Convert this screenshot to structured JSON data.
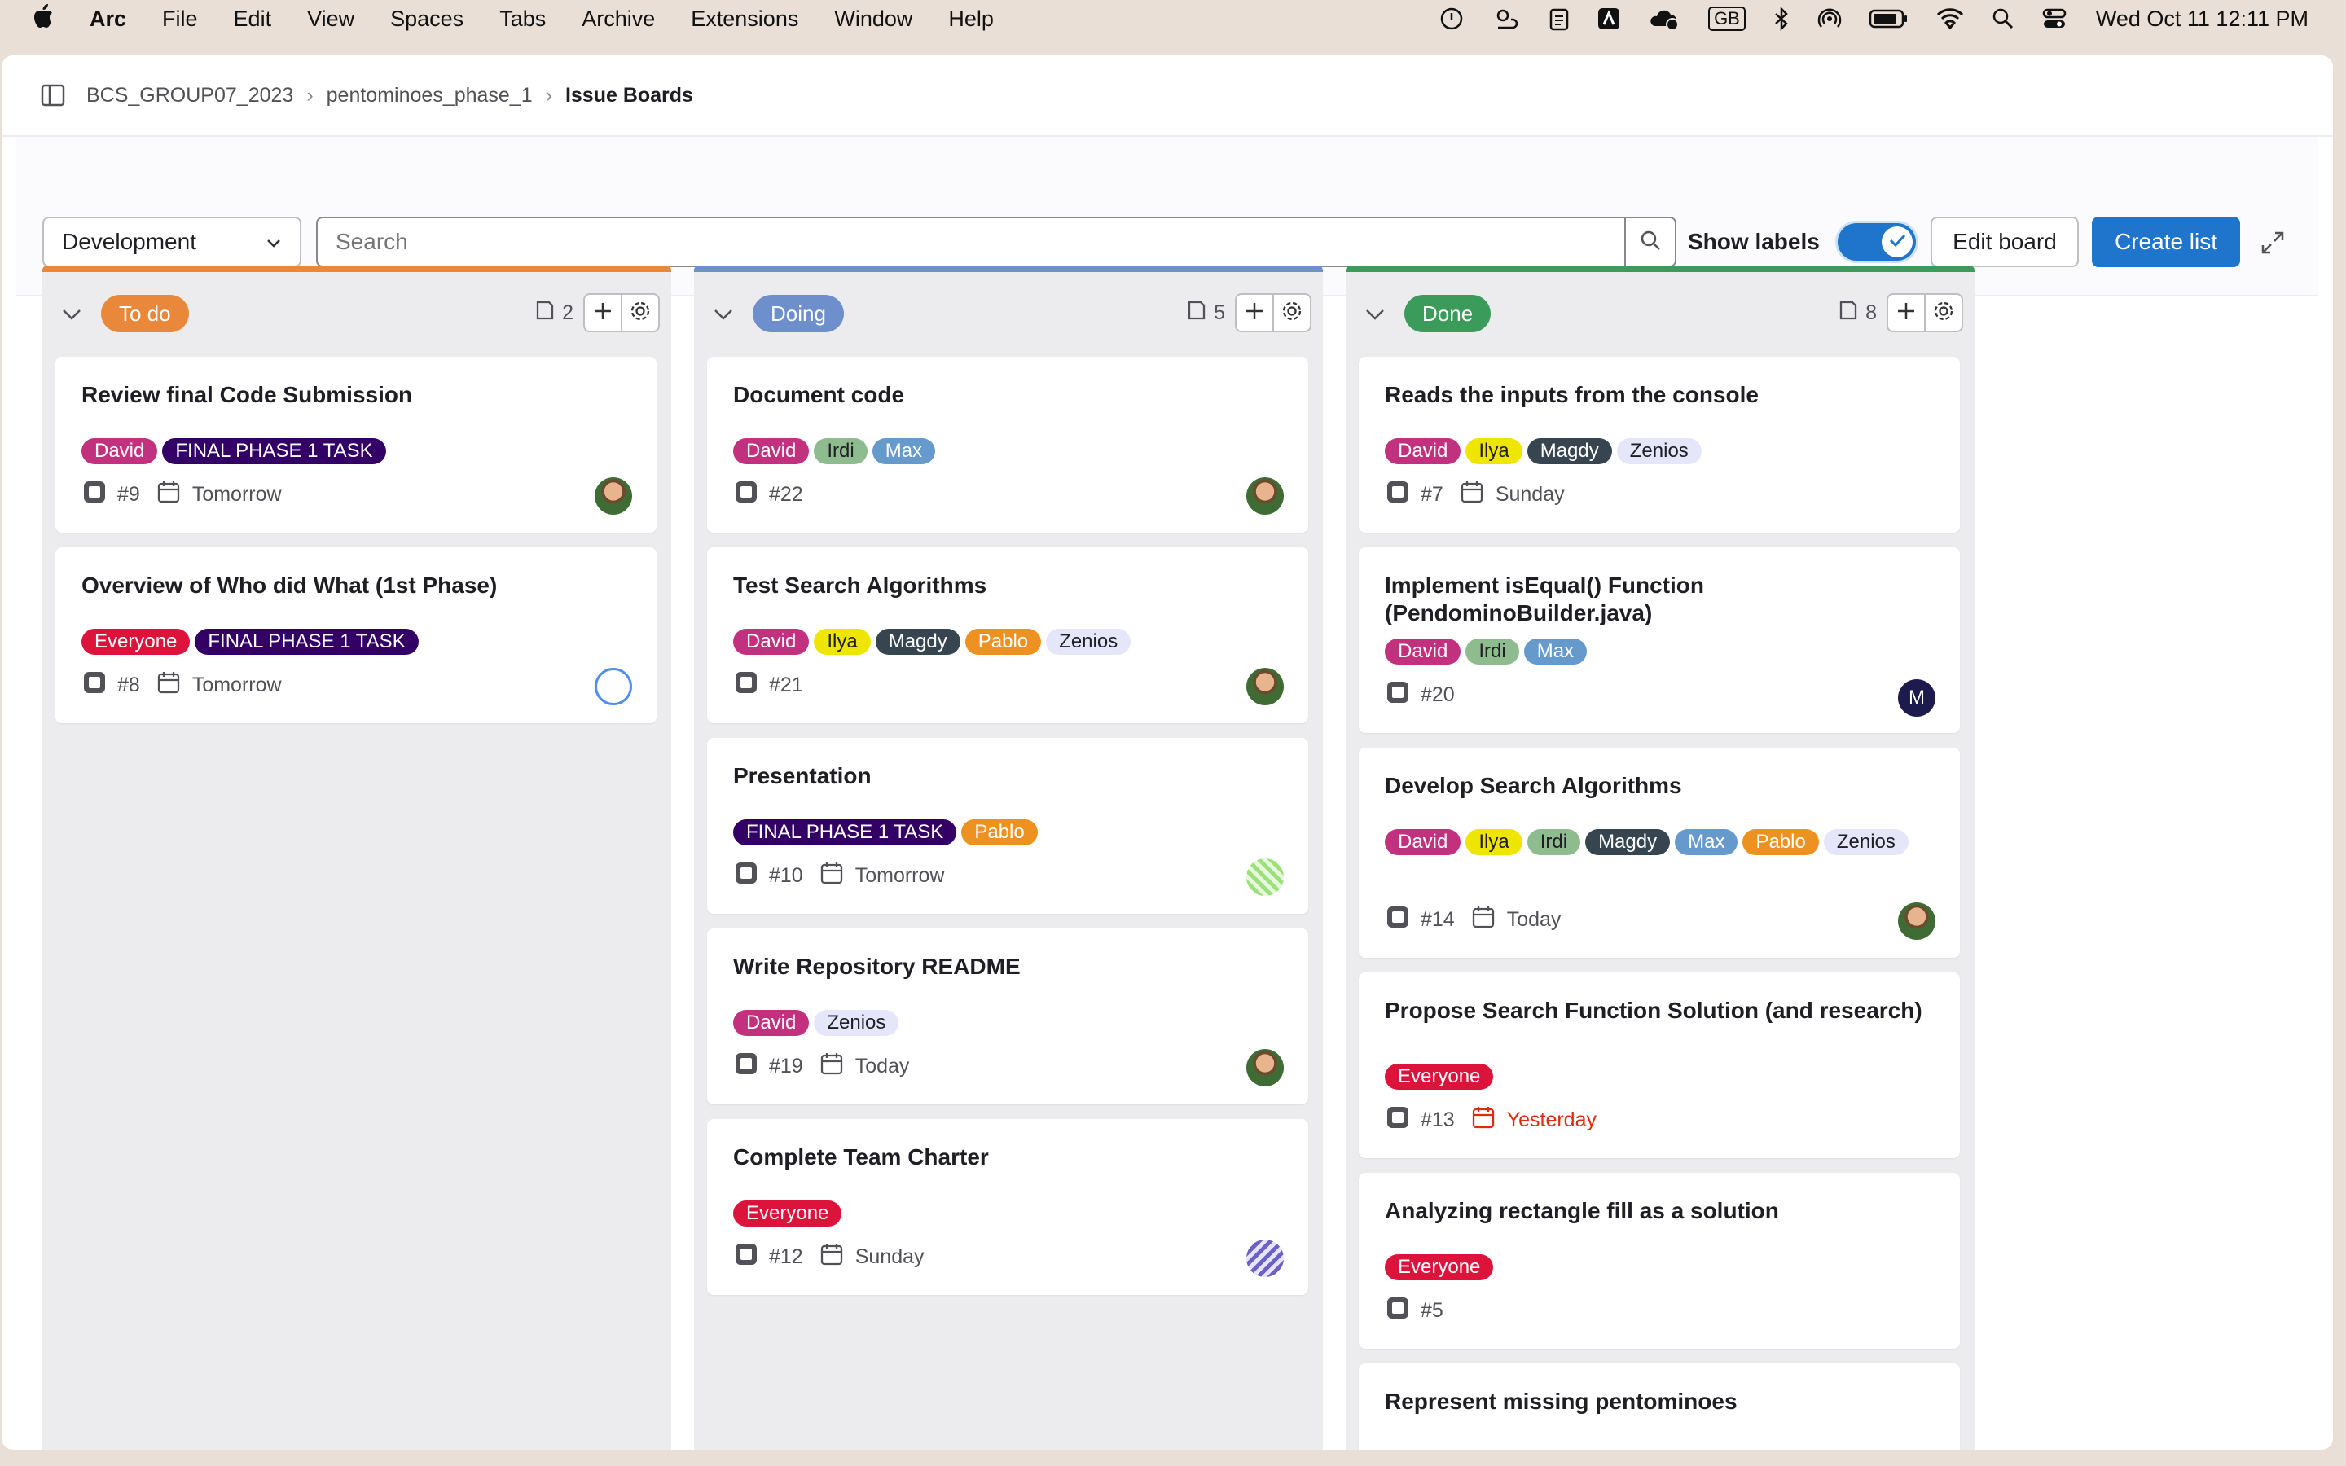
{
  "menubar": {
    "browser": "Arc",
    "items": [
      "File",
      "Edit",
      "View",
      "Spaces",
      "Tabs",
      "Archive",
      "Extensions",
      "Window",
      "Help"
    ],
    "input_source": "GB",
    "clock": "Wed Oct 11  12:11 PM"
  },
  "breadcrumb": {
    "group": "BCS_GROUP07_2023",
    "project": "pentominoes_phase_1",
    "page": "Issue Boards"
  },
  "toolbar": {
    "board_select": "Development",
    "search_placeholder": "Search",
    "show_labels": "Show labels",
    "show_labels_on": true,
    "edit_board": "Edit board",
    "create_list": "Create list"
  },
  "colors": {
    "accent": "#1f75cb",
    "todo": "#e9873a",
    "doing": "#6d8fcb",
    "done": "#3b9b5b"
  },
  "lists": [
    {
      "name": "To do",
      "count": "2",
      "cards": [
        {
          "title": "Review final Code Submission",
          "labels": [
            "David",
            "FINAL PHASE 1 TASK"
          ],
          "number": "#9",
          "due": "Tomorrow",
          "avatar": "photo"
        },
        {
          "title": "Overview of Who did What (1st Phase)",
          "labels": [
            "Everyone",
            "FINAL PHASE 1 TASK"
          ],
          "number": "#8",
          "due": "Tomorrow",
          "avatar": "identicon-blue"
        }
      ]
    },
    {
      "name": "Doing",
      "count": "5",
      "cards": [
        {
          "title": "Document code",
          "labels": [
            "David",
            "Irdi",
            "Max"
          ],
          "number": "#22",
          "due": "",
          "avatar": "photo"
        },
        {
          "title": "Test Search Algorithms",
          "labels": [
            "David",
            "Ilya",
            "Magdy",
            "Pablo",
            "Zenios"
          ],
          "number": "#21",
          "due": "",
          "avatar": "photo"
        },
        {
          "title": "Presentation",
          "labels": [
            "FINAL PHASE 1 TASK",
            "Pablo"
          ],
          "number": "#10",
          "due": "Tomorrow",
          "avatar": "identicon-green"
        },
        {
          "title": "Write Repository README",
          "labels": [
            "David",
            "Zenios"
          ],
          "number": "#19",
          "due": "Today",
          "avatar": "photo"
        },
        {
          "title": "Complete Team Charter",
          "labels": [
            "Everyone"
          ],
          "number": "#12",
          "due": "Sunday",
          "avatar": "identicon-purple"
        }
      ]
    },
    {
      "name": "Done",
      "count": "8",
      "cards": [
        {
          "title": "Reads the inputs from the console",
          "labels": [
            "David",
            "Ilya",
            "Magdy",
            "Zenios"
          ],
          "number": "#7",
          "due": "Sunday",
          "avatar": ""
        },
        {
          "title": "Implement isEqual() Function (PendominoBuilder.java)",
          "labels": [
            "David",
            "Irdi",
            "Max"
          ],
          "number": "#20",
          "due": "",
          "avatar": "letter",
          "avatar_letter": "M"
        },
        {
          "title": "Develop Search Algorithms",
          "labels": [
            "David",
            "Ilya",
            "Irdi",
            "Magdy",
            "Max",
            "Pablo",
            "Zenios"
          ],
          "number": "#14",
          "due": "Today",
          "avatar": "photo"
        },
        {
          "title": "Propose Search Function Solution (and research)",
          "labels": [
            "Everyone"
          ],
          "number": "#13",
          "due": "Yesterday",
          "overdue": true,
          "avatar": ""
        },
        {
          "title": "Analyzing rectangle fill as a solution",
          "labels": [
            "Everyone"
          ],
          "number": "#5",
          "due": "",
          "avatar": ""
        },
        {
          "title": "Represent missing pentominoes",
          "labels": [],
          "number": "",
          "due": "",
          "avatar": ""
        }
      ]
    }
  ],
  "label_colors": {
    "David": {
      "bg": "#c2317e",
      "fg": "#ffffff"
    },
    "FINAL PHASE 1 TASK": {
      "bg": "#330066",
      "fg": "#ffffff"
    },
    "Everyone": {
      "bg": "#dc143c",
      "fg": "#ffffff"
    },
    "Irdi": {
      "bg": "#8fbc8f",
      "fg": "#1f1e24"
    },
    "Max": {
      "bg": "#6699cc",
      "fg": "#ffffff"
    },
    "Ilya": {
      "bg": "#eee600",
      "fg": "#1f1e24"
    },
    "Magdy": {
      "bg": "#36454f",
      "fg": "#ffffff"
    },
    "Pablo": {
      "bg": "#ed9121",
      "fg": "#ffffff"
    },
    "Zenios": {
      "bg": "#e6e6fa",
      "fg": "#1f1e24"
    }
  }
}
